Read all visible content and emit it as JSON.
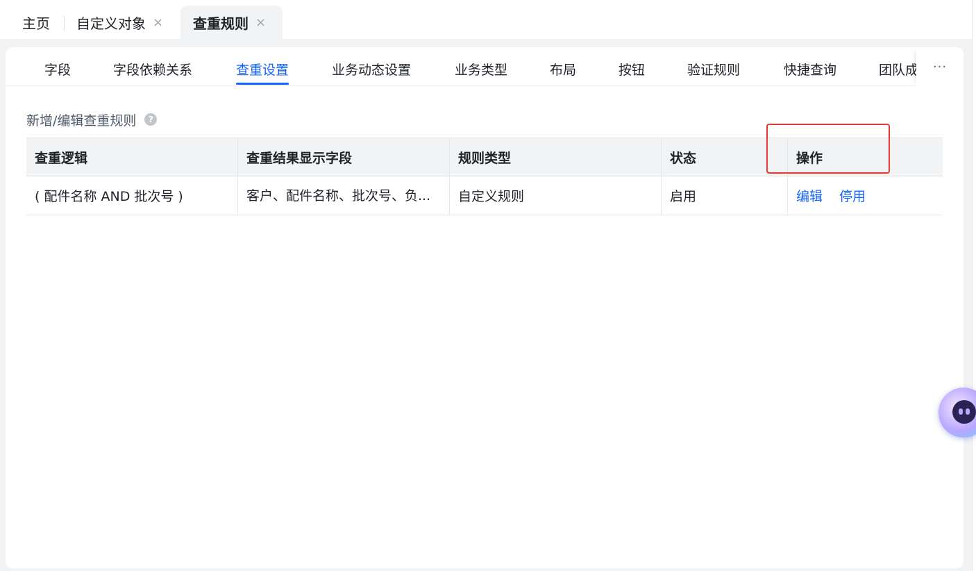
{
  "page_tabs": {
    "home": "主页",
    "custom_object": "自定义对象",
    "active": "查重规则",
    "close_glyph": "×"
  },
  "sub_tabs": [
    "字段",
    "字段依赖关系",
    "查重设置",
    "业务动态设置",
    "业务类型",
    "布局",
    "按钮",
    "验证规则",
    "快捷查询",
    "团队成"
  ],
  "active_sub_tab": "查重设置",
  "more_glyph": "···",
  "section": {
    "title": "新增/编辑查重规则",
    "help_glyph": "?"
  },
  "table": {
    "headers": [
      "查重逻辑",
      "查重结果显示字段",
      "规则类型",
      "状态",
      "操作"
    ],
    "rows": [
      {
        "logic": "( 配件名称 AND 批次号 )",
        "display_fields": "客户、配件名称、批次号、负...",
        "rule_type": "自定义规则",
        "status": "启用",
        "actions": [
          "编辑",
          "停用"
        ]
      }
    ]
  },
  "colors": {
    "accent": "#1664ff",
    "highlight": "#e53935"
  }
}
